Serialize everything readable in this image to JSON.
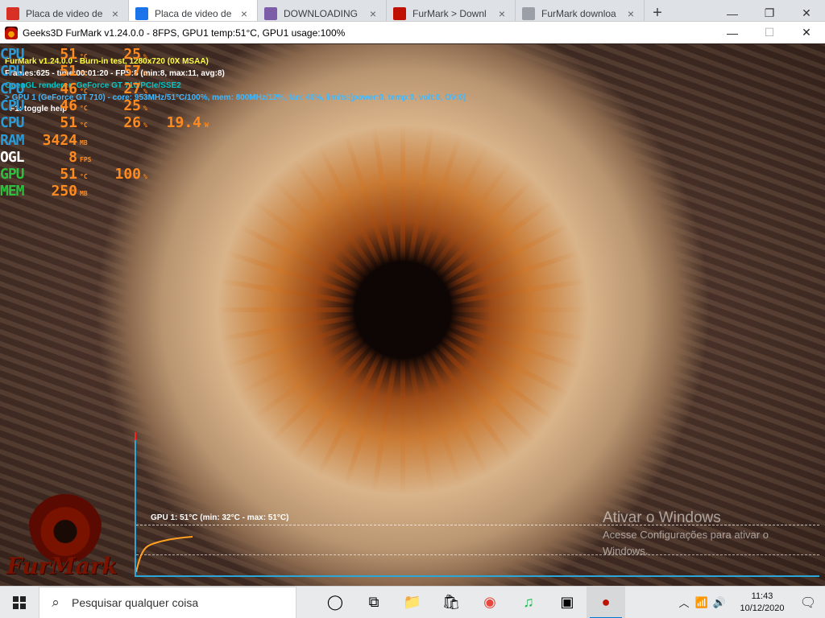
{
  "browser": {
    "tabs": [
      {
        "label": "Placa de video de",
        "favicon": "gmail-icon",
        "color": "#d93025",
        "active": false
      },
      {
        "label": "Placa de video de",
        "favicon": "globe-icon",
        "color": "#1a73e8",
        "active": true
      },
      {
        "label": "DOWNLOADING",
        "favicon": "epic-icon",
        "color": "#7b5ea7",
        "active": false
      },
      {
        "label": "FurMark > Downl",
        "favicon": "furmark-icon",
        "color": "#c01000",
        "active": false
      },
      {
        "label": "FurMark downloa",
        "favicon": "loading-icon",
        "color": "#9aa0a6",
        "active": false
      }
    ],
    "new_tab": "+",
    "controls": {
      "minimize": "—",
      "maximize": "❐",
      "close": "✕"
    }
  },
  "window": {
    "title": "Geeks3D FurMark v1.24.0.0 - 8FPS, GPU1 temp:51°C, GPU1 usage:100%",
    "controls": {
      "minimize": "—",
      "maximize": "☐",
      "close": "✕"
    }
  },
  "overlay": {
    "info_lines": [
      {
        "text": "FurMark v1.24.0.0 - Burn-in test, 1280x720 (0X MSAA)",
        "color": "#ffff40"
      },
      {
        "text": "Frames:625 - time:00:01:20 - FPS:8 (min:8, max:11, avg:8)",
        "color": "#ffffff"
      },
      {
        "text": "OpenGL renderer: GeForce GT 710/PCIe/SSE2",
        "color": "#00c8c8"
      },
      {
        "text": "> GPU 1 (GeForce GT 710) - core: 953MHz/51°C/100%, mem: 800MHz/12%, fan: 40%, limits:[power:0, temp:0, volt:0, OV:0]",
        "color": "#3fb8ff"
      },
      {
        "text": "- F1: toggle help",
        "color": "#ffffff"
      }
    ],
    "stats": [
      {
        "label": "CPU",
        "label_color": "#2b9bd8",
        "value": "51",
        "unit": "°C",
        "value2": "25",
        "unit2": "%",
        "value3": "",
        "unit3": ""
      },
      {
        "label": "CPU",
        "label_color": "#2b9bd8",
        "value": "51",
        "unit": "°C",
        "value2": "57",
        "unit2": "%",
        "value3": "",
        "unit3": ""
      },
      {
        "label": "CPU",
        "label_color": "#2b9bd8",
        "value": "46",
        "unit": "°C",
        "value2": "27",
        "unit2": "%",
        "value3": "",
        "unit3": ""
      },
      {
        "label": "CPU",
        "label_color": "#2b9bd8",
        "value": "46",
        "unit": "°C",
        "value2": "25",
        "unit2": "%",
        "value3": "",
        "unit3": ""
      },
      {
        "label": "CPU",
        "label_color": "#2b9bd8",
        "value": "51",
        "unit": "°C",
        "value2": "26",
        "unit2": "%",
        "value3": "19.4",
        "unit3": "W"
      },
      {
        "label": "RAM",
        "label_color": "#2b9bd8",
        "value": "3424",
        "unit": "MB",
        "value2": "",
        "unit2": "",
        "value3": "",
        "unit3": ""
      },
      {
        "label": "OGL",
        "label_color": "#ffffff",
        "value": "8",
        "unit": "FPS",
        "value2": "",
        "unit2": "",
        "value3": "",
        "unit3": ""
      },
      {
        "label": "GPU",
        "label_color": "#2fbf3f",
        "value": "51",
        "unit": "°C",
        "value2": "100",
        "unit2": "%",
        "value3": "",
        "unit3": ""
      },
      {
        "label": "MEM",
        "label_color": "#2fbf3f",
        "value": "250",
        "unit": "MB",
        "value2": "",
        "unit2": "",
        "value3": "",
        "unit3": ""
      }
    ],
    "graph_label": "GPU 1: 51°C (min: 32°C - max: 51°C)",
    "watermark": {
      "title": "Ativar o Windows",
      "subtitle": "Acesse Configurações para ativar o Windows."
    },
    "logo_text": "FurMark"
  },
  "taskbar": {
    "search_placeholder": "Pesquisar qualquer coisa",
    "apps": [
      {
        "name": "task-view-icon",
        "glyph": "◯",
        "active": false
      },
      {
        "name": "multitask-icon",
        "glyph": "⧉",
        "active": false
      },
      {
        "name": "file-explorer-icon",
        "glyph": "📁",
        "active": false
      },
      {
        "name": "store-icon",
        "glyph": "🛍",
        "active": false
      },
      {
        "name": "chrome-icon",
        "glyph": "◉",
        "active": false
      },
      {
        "name": "music-app-icon",
        "glyph": "♫",
        "active": false
      },
      {
        "name": "cpu-app-icon",
        "glyph": "▣",
        "active": false
      },
      {
        "name": "furmark-icon",
        "glyph": "●",
        "active": true
      }
    ],
    "time": "11:43",
    "date": "10/12/2020"
  }
}
